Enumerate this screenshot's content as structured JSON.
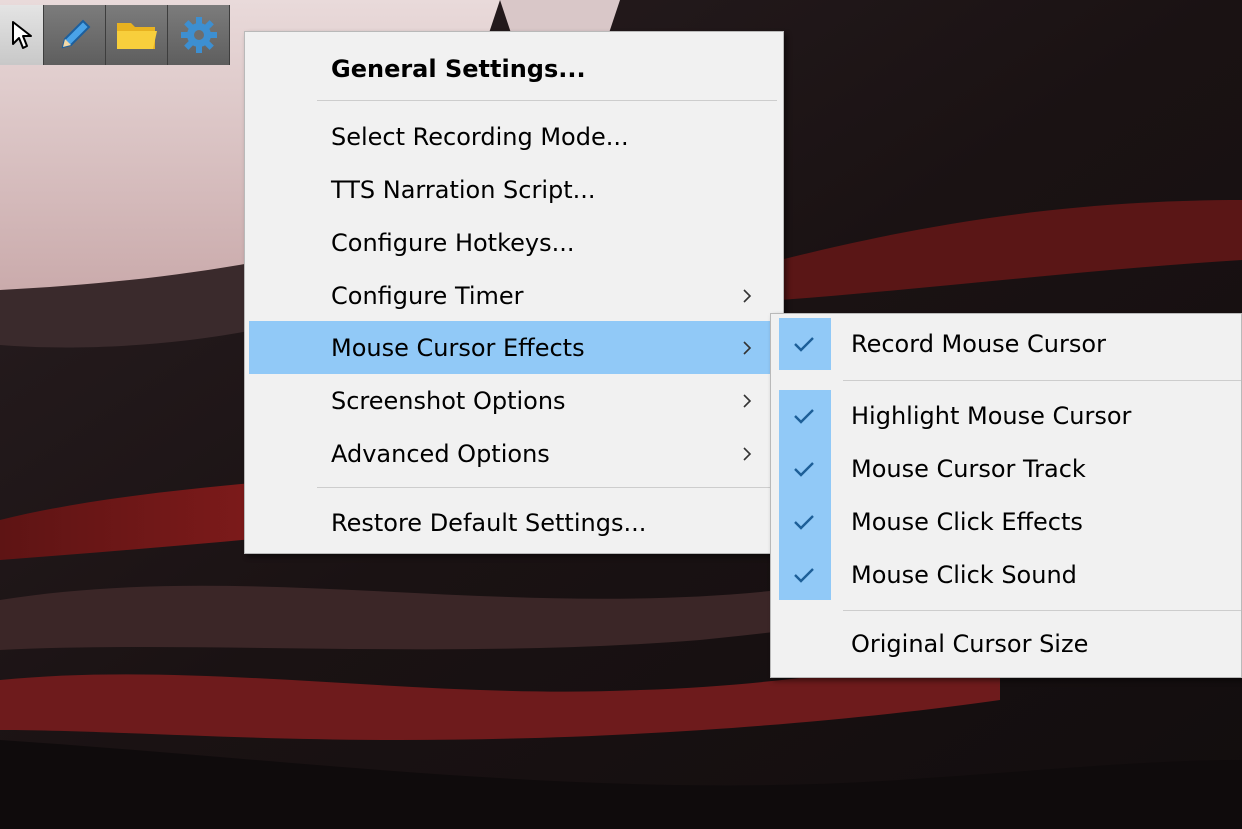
{
  "toolbar": {
    "buttons": [
      {
        "icon": "cursor-arrow-icon"
      },
      {
        "icon": "pencil-icon"
      },
      {
        "icon": "folder-icon"
      },
      {
        "icon": "gear-icon"
      }
    ]
  },
  "settings_menu": {
    "items": [
      {
        "label": "General Settings...",
        "bold": true
      },
      {
        "label": "Select Recording Mode..."
      },
      {
        "label": "TTS Narration Script..."
      },
      {
        "label": "Configure Hotkeys..."
      },
      {
        "label": "Configure Timer",
        "submenu": true
      },
      {
        "label": "Mouse Cursor Effects",
        "submenu": true,
        "highlighted": true
      },
      {
        "label": "Screenshot Options",
        "submenu": true
      },
      {
        "label": "Advanced Options",
        "submenu": true
      },
      {
        "label": "Restore Default Settings..."
      }
    ]
  },
  "mouse_cursor_submenu": {
    "items": [
      {
        "label": "Record Mouse Cursor",
        "checked": true
      },
      {
        "label": "Highlight Mouse Cursor",
        "checked": true
      },
      {
        "label": "Mouse Cursor Track",
        "checked": true
      },
      {
        "label": "Mouse Click Effects",
        "checked": true
      },
      {
        "label": "Mouse Click Sound",
        "checked": true
      },
      {
        "label": "Original Cursor Size",
        "checked": false
      }
    ]
  },
  "colors": {
    "menu_background": "#f1f1f1",
    "highlight": "#91c9f7",
    "separator": "#cdcdcd",
    "check_mark": "#1d5f98"
  }
}
